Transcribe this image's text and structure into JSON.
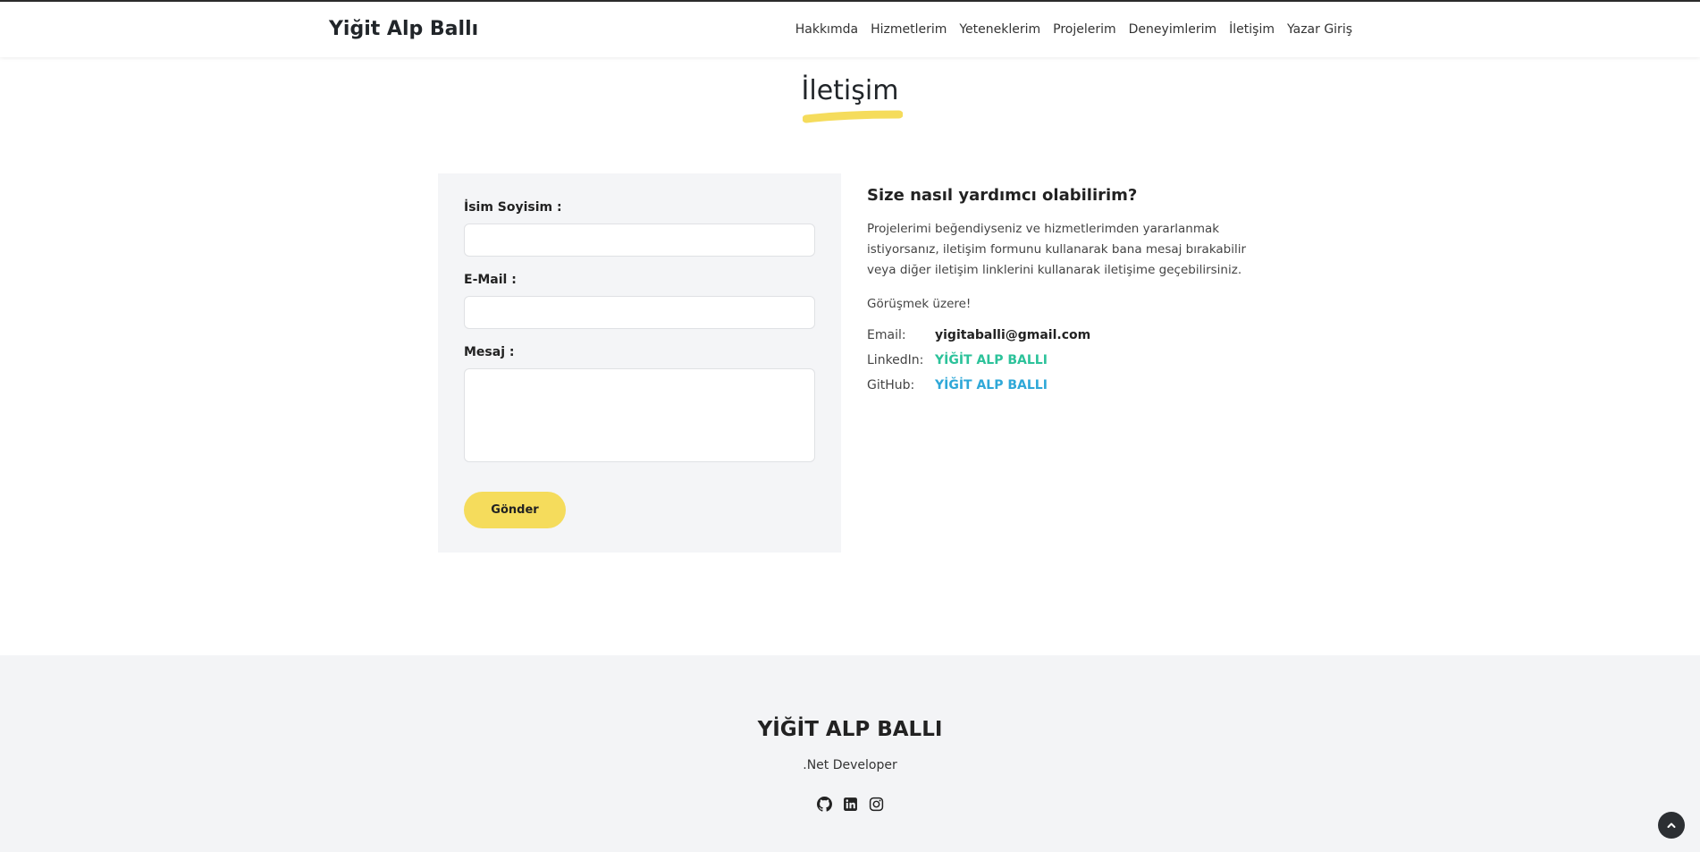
{
  "header": {
    "brand": "Yiğit Alp Ballı",
    "nav": [
      "Hakkımda",
      "Hizmetlerim",
      "Yeteneklerim",
      "Projelerim",
      "Deneyimlerim",
      "İletişim",
      "Yazar Giriş"
    ]
  },
  "section": {
    "title": "İletişim"
  },
  "form": {
    "name_label": "İsim Soyisim :",
    "email_label": "E-Mail :",
    "message_label": "Mesaj :",
    "submit_label": "Gönder"
  },
  "info": {
    "heading": "Size nasıl yardımcı olabilirim?",
    "paragraph": "Projelerimi beğendiyseniz ve hizmetlerimden yararlanmak istiyorsanız, iletişim formunu kullanarak bana mesaj bırakabilir veya diğer iletişim linklerini kullanarak iletişime geçebilirsiniz.",
    "closing": "Görüşmek üzere!",
    "contacts": [
      {
        "key": "Email:",
        "value": "yigitaballi@gmail.com"
      },
      {
        "key": "LinkedIn:",
        "value": "YİĞİT ALP BALLI"
      },
      {
        "key": "GitHub:",
        "value": "YİĞİT ALP BALLI"
      }
    ]
  },
  "footer": {
    "name": "YİĞİT ALP BALLI",
    "role": ".Net Developer",
    "icons": [
      "github-icon",
      "linkedin-icon",
      "instagram-icon"
    ]
  },
  "colors": {
    "accent_yellow": "#f5dc5c",
    "linkedin_link": "#2cc29a",
    "github_link": "#2fa8d8"
  }
}
